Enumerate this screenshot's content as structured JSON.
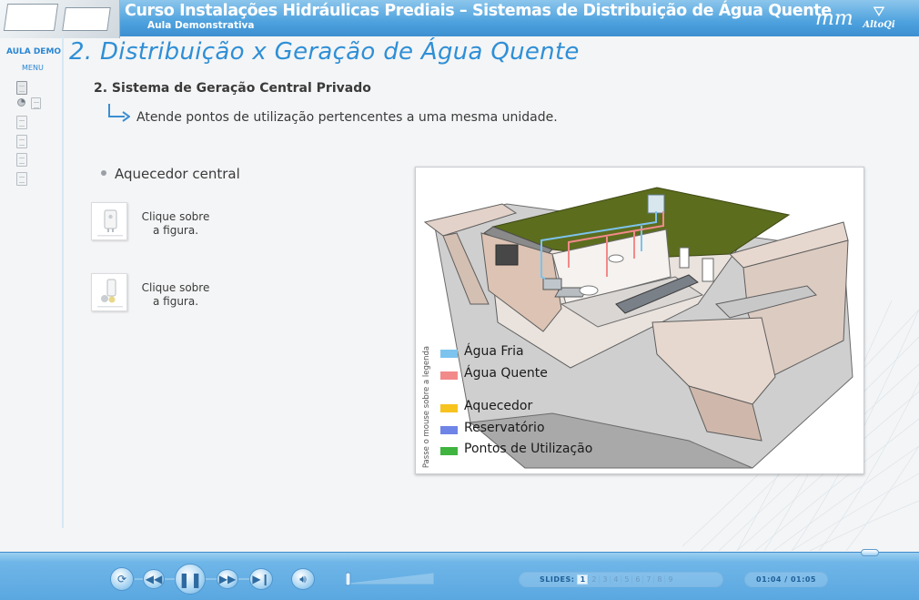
{
  "header": {
    "title": "Curso Instalações Hidráulicas Prediais – Sistemas de Distribuição de Água Quente",
    "subtitle": "Aula Demonstrativa",
    "logo_mm": "mm",
    "logo_alto": "AltoQi"
  },
  "sidebar": {
    "aula_demo": "AULA DEMO",
    "menu": "MENU",
    "items": [
      {
        "icon": "document-icon",
        "active": true
      },
      {
        "icon": "pie-chart-icon",
        "active": false
      },
      {
        "icon": "document-icon",
        "active": false
      },
      {
        "icon": "document-icon",
        "active": false
      },
      {
        "icon": "document-icon",
        "active": false
      },
      {
        "icon": "document-icon",
        "active": false
      }
    ]
  },
  "main": {
    "title": "2. Distribuição x Geração de Água Quente",
    "section_heading": "2. Sistema  de Geração Central Privado",
    "description": "Atende pontos de utilização pertencentes a uma mesma unidade.",
    "bullet": "Aquecedor central",
    "thumbnails": [
      {
        "caption_line1": "Clique sobre",
        "caption_line2": "a figura."
      },
      {
        "caption_line1": "Clique sobre",
        "caption_line2": "a figura."
      }
    ]
  },
  "figure": {
    "side_note": "Passe o mouse sobre a legenda",
    "legend": [
      {
        "label": "Água Fria",
        "color": "#7cc3ee"
      },
      {
        "label": "Água Quente",
        "color": "#f28a8a"
      },
      {
        "label": "Aquecedor",
        "color": "#f7c31e"
      },
      {
        "label": "Reservatório",
        "color": "#6e84e6"
      },
      {
        "label": "Pontos de Utilização",
        "color": "#3fb43f"
      }
    ]
  },
  "controls": {
    "slides_label": "SLIDES:",
    "slides": [
      "1",
      "2",
      "3",
      "4",
      "5",
      "6",
      "7",
      "8",
      "9"
    ],
    "current_slide": "1",
    "time": "01:04 / 01:05",
    "buttons": [
      "replay-icon",
      "rewind-icon",
      "pause-icon",
      "forward-icon",
      "skip-end-icon",
      "volume-icon"
    ],
    "progress": 0.95
  }
}
